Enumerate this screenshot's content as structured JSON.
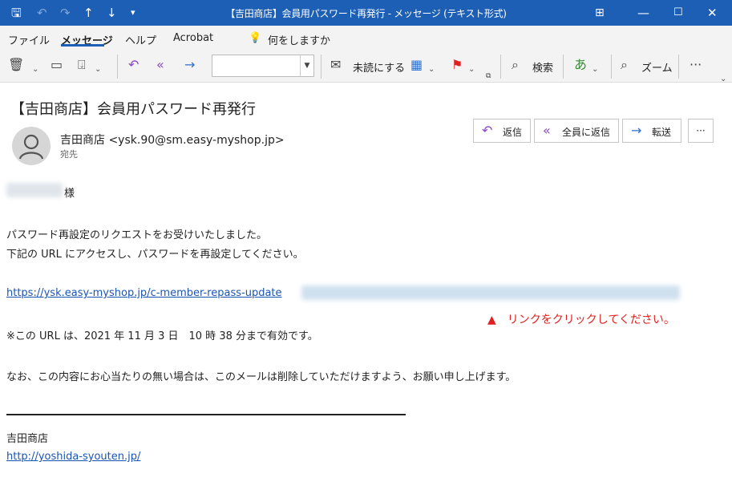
{
  "window": {
    "title": "【吉田商店】会員用パスワード再発行  -  メッセージ (テキスト形式)",
    "quick_access": [
      "save-icon",
      "undo-icon",
      "redo-icon",
      "up-arrow-icon",
      "down-arrow-icon",
      "customize-icon"
    ],
    "controls": [
      "ribbon-display-icon",
      "minimize-icon",
      "maximize-icon",
      "close-icon"
    ]
  },
  "menu": {
    "items": [
      "ファイル",
      "メッセージ",
      "ヘルプ",
      "Acrobat"
    ],
    "active": "メッセージ",
    "tell_me": "何をしますか"
  },
  "ribbon": {
    "mark_unread": "未読にする",
    "search": "検索",
    "zoom": "ズーム",
    "combo_value": ""
  },
  "message": {
    "subject": "【吉田商店】会員用パスワード再発行",
    "sender": "吉田商店 <ysk.90@sm.easy-myshop.jp>",
    "to_label": "宛先",
    "actions": {
      "reply": "返信",
      "reply_all": "全員に返信",
      "forward": "転送",
      "more": "···"
    }
  },
  "body": {
    "salutation_suffix": "様",
    "line1": "パスワード再設定のリクエストをお受けいたしました。",
    "line2": "下記の URL にアクセスし、パスワードを再設定してください。",
    "reset_link": "https://ysk.easy-myshop.jp/c-member-repass-update",
    "link_note": "▲　リンクをクリックしてください。",
    "validity": "※この URL は、2021 年 11 月 3 日　10 時 38 分まで有効です。",
    "closing": "なお、この内容にお心当たりの無い場合は、このメールは削除していただけますよう、お願い申し上げます。",
    "signature_name": "吉田商店",
    "signature_url": "http://yoshida-syouten.jp/"
  },
  "colors": {
    "accent": "#1d5fb5",
    "link": "#1a55b5",
    "note": "#e02020"
  }
}
